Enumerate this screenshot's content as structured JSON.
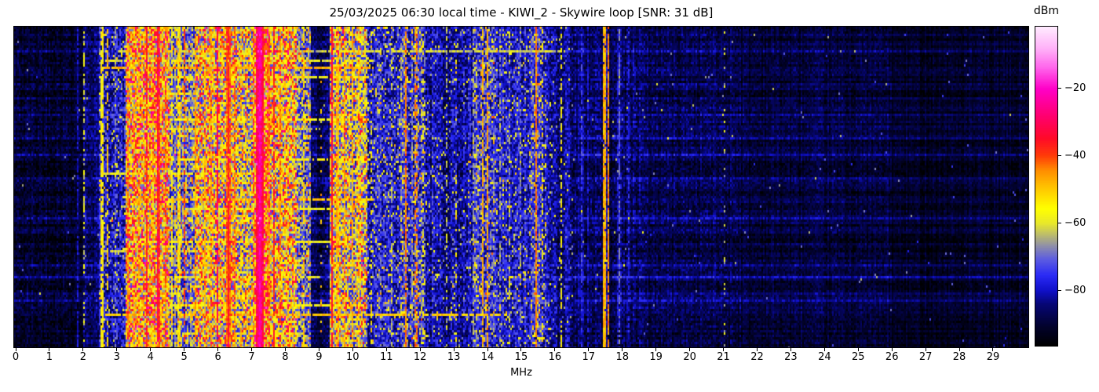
{
  "chart_data": {
    "type": "heatmap",
    "subtype": "radio-spectrum-waterfall",
    "title": "25/03/2025 06:30 local time - KIWI_2 - Skywire loop [SNR: 31 dB]",
    "datetime": "25/03/2025 06:30",
    "receiver": "KIWI_2",
    "antenna": "Skywire loop",
    "snr_db": 31,
    "xlabel": "MHz",
    "x_range_mhz": [
      -0.05,
      30.05
    ],
    "x_ticks": [
      "0",
      "1",
      "2",
      "3",
      "4",
      "5",
      "6",
      "7",
      "8",
      "9",
      "10",
      "11",
      "12",
      "13",
      "14",
      "15",
      "16",
      "17",
      "18",
      "19",
      "20",
      "21",
      "22",
      "23",
      "24",
      "25",
      "26",
      "27",
      "28",
      "29"
    ],
    "colorbar": {
      "label": "dBm",
      "vmax_dbm": -1.6,
      "vmin_dbm": -96.4,
      "ticks": [
        {
          "value": -20,
          "label": "−20"
        },
        {
          "value": -40,
          "label": "−40"
        },
        {
          "value": -60,
          "label": "−60"
        },
        {
          "value": -80,
          "label": "−80"
        }
      ]
    },
    "colormap_stops": [
      [
        0.0,
        [
          0,
          0,
          0
        ]
      ],
      [
        0.06,
        [
          2,
          2,
          45
        ]
      ],
      [
        0.13,
        [
          6,
          6,
          118
        ]
      ],
      [
        0.172,
        [
          16,
          16,
          200
        ]
      ],
      [
        0.22,
        [
          42,
          42,
          245
        ]
      ],
      [
        0.27,
        [
          92,
          92,
          225
        ]
      ],
      [
        0.31,
        [
          140,
          140,
          172
        ]
      ],
      [
        0.345,
        [
          185,
          185,
          112
        ]
      ],
      [
        0.383,
        [
          232,
          232,
          42
        ]
      ],
      [
        0.43,
        [
          255,
          255,
          0
        ]
      ],
      [
        0.5,
        [
          255,
          192,
          0
        ]
      ],
      [
        0.55,
        [
          255,
          140,
          0
        ]
      ],
      [
        0.595,
        [
          255,
          60,
          8
        ]
      ],
      [
        0.65,
        [
          255,
          10,
          40
        ]
      ],
      [
        0.72,
        [
          255,
          0,
          110
        ]
      ],
      [
        0.806,
        [
          255,
          0,
          200
        ]
      ],
      [
        0.87,
        [
          255,
          98,
          235
        ]
      ],
      [
        0.93,
        [
          255,
          175,
          248
        ]
      ],
      [
        1.0,
        [
          255,
          235,
          255
        ]
      ]
    ],
    "noise_floor_bands": [
      {
        "from_mhz": 0.0,
        "to_mhz": 2.0,
        "floor_dbm": -91,
        "spread_db": 10
      },
      {
        "from_mhz": 2.0,
        "to_mhz": 2.45,
        "floor_dbm": -86,
        "spread_db": 12
      },
      {
        "from_mhz": 2.45,
        "to_mhz": 3.25,
        "floor_dbm": -80,
        "spread_db": 18
      },
      {
        "from_mhz": 3.25,
        "to_mhz": 4.55,
        "floor_dbm": -58,
        "spread_db": 30
      },
      {
        "from_mhz": 4.55,
        "to_mhz": 5.35,
        "floor_dbm": -72,
        "spread_db": 22
      },
      {
        "from_mhz": 5.35,
        "to_mhz": 6.55,
        "floor_dbm": -62,
        "spread_db": 28
      },
      {
        "from_mhz": 6.55,
        "to_mhz": 7.05,
        "floor_dbm": -66,
        "spread_db": 26
      },
      {
        "from_mhz": 7.05,
        "to_mhz": 7.55,
        "floor_dbm": -52,
        "spread_db": 28
      },
      {
        "from_mhz": 7.55,
        "to_mhz": 8.35,
        "floor_dbm": -62,
        "spread_db": 28
      },
      {
        "from_mhz": 8.35,
        "to_mhz": 8.75,
        "floor_dbm": -72,
        "spread_db": 22
      },
      {
        "from_mhz": 8.75,
        "to_mhz": 9.3,
        "floor_dbm": -88,
        "spread_db": 12
      },
      {
        "from_mhz": 9.3,
        "to_mhz": 10.45,
        "floor_dbm": -66,
        "spread_db": 26
      },
      {
        "from_mhz": 10.45,
        "to_mhz": 11.4,
        "floor_dbm": -78,
        "spread_db": 18
      },
      {
        "from_mhz": 11.4,
        "to_mhz": 12.15,
        "floor_dbm": -75,
        "spread_db": 20
      },
      {
        "from_mhz": 12.15,
        "to_mhz": 13.55,
        "floor_dbm": -82,
        "spread_db": 16
      },
      {
        "from_mhz": 13.55,
        "to_mhz": 14.2,
        "floor_dbm": -77,
        "spread_db": 20
      },
      {
        "from_mhz": 14.2,
        "to_mhz": 15.3,
        "floor_dbm": -80,
        "spread_db": 16
      },
      {
        "from_mhz": 15.3,
        "to_mhz": 15.75,
        "floor_dbm": -77,
        "spread_db": 18
      },
      {
        "from_mhz": 15.75,
        "to_mhz": 16.55,
        "floor_dbm": -83,
        "spread_db": 14
      },
      {
        "from_mhz": 16.55,
        "to_mhz": 18.6,
        "floor_dbm": -86,
        "spread_db": 12
      },
      {
        "from_mhz": 18.6,
        "to_mhz": 21.5,
        "floor_dbm": -88,
        "spread_db": 10
      },
      {
        "from_mhz": 21.5,
        "to_mhz": 26.0,
        "floor_dbm": -90,
        "spread_db": 8
      },
      {
        "from_mhz": 26.0,
        "to_mhz": 30.1,
        "floor_dbm": -92,
        "spread_db": 6
      }
    ],
    "carriers": [
      {
        "mhz": 1.84,
        "width_mhz": 0.04,
        "peak_dbm": -80,
        "duty": 0.8
      },
      {
        "mhz": 2.04,
        "width_mhz": 0.05,
        "peak_dbm": -60,
        "duty": 0.45
      },
      {
        "mhz": 2.56,
        "width_mhz": 0.07,
        "peak_dbm": -48,
        "duty": 0.85
      },
      {
        "mhz": 2.72,
        "width_mhz": 0.05,
        "peak_dbm": -50,
        "duty": 0.6
      },
      {
        "mhz": 2.95,
        "width_mhz": 0.05,
        "peak_dbm": -70,
        "duty": 0.5
      },
      {
        "mhz": 3.33,
        "width_mhz": 0.06,
        "peak_dbm": -46,
        "duty": 0.8
      },
      {
        "mhz": 3.52,
        "width_mhz": 0.05,
        "peak_dbm": -49,
        "duty": 0.7
      },
      {
        "mhz": 3.64,
        "width_mhz": 0.05,
        "peak_dbm": -42,
        "duty": 0.7
      },
      {
        "mhz": 3.9,
        "width_mhz": 0.07,
        "peak_dbm": -37,
        "duty": 0.9
      },
      {
        "mhz": 4.05,
        "width_mhz": 0.05,
        "peak_dbm": -47,
        "duty": 0.8
      },
      {
        "mhz": 4.22,
        "width_mhz": 0.09,
        "peak_dbm": -33,
        "duty": 0.95
      },
      {
        "mhz": 4.46,
        "width_mhz": 0.05,
        "peak_dbm": -44,
        "duty": 0.7
      },
      {
        "mhz": 4.65,
        "width_mhz": 0.05,
        "peak_dbm": -50,
        "duty": 0.6
      },
      {
        "mhz": 4.85,
        "width_mhz": 0.06,
        "peak_dbm": -47,
        "duty": 0.75
      },
      {
        "mhz": 5.0,
        "width_mhz": 0.05,
        "peak_dbm": -40,
        "duty": 0.6
      },
      {
        "mhz": 5.35,
        "width_mhz": 0.06,
        "peak_dbm": -46,
        "duty": 0.8
      },
      {
        "mhz": 5.62,
        "width_mhz": 0.05,
        "peak_dbm": -49,
        "duty": 0.6
      },
      {
        "mhz": 5.8,
        "width_mhz": 0.05,
        "peak_dbm": -46,
        "duty": 0.7
      },
      {
        "mhz": 5.98,
        "width_mhz": 0.05,
        "peak_dbm": -31,
        "duty": 0.9
      },
      {
        "mhz": 6.3,
        "width_mhz": 0.12,
        "peak_dbm": -36,
        "duty": 0.95
      },
      {
        "mhz": 6.48,
        "width_mhz": 0.04,
        "peak_dbm": -38,
        "duty": 0.8
      },
      {
        "mhz": 6.68,
        "width_mhz": 0.05,
        "peak_dbm": -50,
        "duty": 0.6
      },
      {
        "mhz": 6.88,
        "width_mhz": 0.05,
        "peak_dbm": -52,
        "duty": 0.5
      },
      {
        "mhz": 7.25,
        "width_mhz": 0.22,
        "peak_dbm": -27,
        "duty": 1.0
      },
      {
        "mhz": 7.5,
        "width_mhz": 0.05,
        "peak_dbm": -38,
        "duty": 0.8
      },
      {
        "mhz": 7.65,
        "width_mhz": 0.05,
        "peak_dbm": -37,
        "duty": 0.8
      },
      {
        "mhz": 7.85,
        "width_mhz": 0.06,
        "peak_dbm": -44,
        "duty": 0.8
      },
      {
        "mhz": 8.05,
        "width_mhz": 0.05,
        "peak_dbm": -50,
        "duty": 0.6
      },
      {
        "mhz": 8.25,
        "width_mhz": 0.05,
        "peak_dbm": -53,
        "duty": 0.5
      },
      {
        "mhz": 8.55,
        "width_mhz": 0.05,
        "peak_dbm": -52,
        "duty": 0.55
      },
      {
        "mhz": 9.05,
        "width_mhz": 0.04,
        "peak_dbm": -48,
        "duty": 0.15
      },
      {
        "mhz": 9.4,
        "width_mhz": 0.06,
        "peak_dbm": -35,
        "duty": 0.9
      },
      {
        "mhz": 9.55,
        "width_mhz": 0.05,
        "peak_dbm": -42,
        "duty": 0.8
      },
      {
        "mhz": 9.76,
        "width_mhz": 0.06,
        "peak_dbm": -47,
        "duty": 0.85
      },
      {
        "mhz": 10.0,
        "width_mhz": 0.06,
        "peak_dbm": -48,
        "duty": 0.8
      },
      {
        "mhz": 10.18,
        "width_mhz": 0.05,
        "peak_dbm": -51,
        "duty": 0.55
      },
      {
        "mhz": 10.55,
        "width_mhz": 0.05,
        "peak_dbm": -53,
        "duty": 0.4
      },
      {
        "mhz": 11.15,
        "width_mhz": 0.04,
        "peak_dbm": -62,
        "duty": 0.4
      },
      {
        "mhz": 11.58,
        "width_mhz": 0.06,
        "peak_dbm": -44,
        "duty": 0.9
      },
      {
        "mhz": 11.88,
        "width_mhz": 0.05,
        "peak_dbm": -37,
        "duty": 0.5
      },
      {
        "mhz": 12.1,
        "width_mhz": 0.04,
        "peak_dbm": -58,
        "duty": 0.5
      },
      {
        "mhz": 12.8,
        "width_mhz": 0.04,
        "peak_dbm": -62,
        "duty": 0.4
      },
      {
        "mhz": 13.05,
        "width_mhz": 0.04,
        "peak_dbm": -46,
        "duty": 0.25
      },
      {
        "mhz": 13.6,
        "width_mhz": 0.04,
        "peak_dbm": -58,
        "duty": 0.5
      },
      {
        "mhz": 13.85,
        "width_mhz": 0.05,
        "peak_dbm": -48,
        "duty": 0.7
      },
      {
        "mhz": 14.0,
        "width_mhz": 0.05,
        "peak_dbm": -46,
        "duty": 0.7
      },
      {
        "mhz": 14.35,
        "width_mhz": 0.04,
        "peak_dbm": -58,
        "duty": 0.4
      },
      {
        "mhz": 14.65,
        "width_mhz": 0.04,
        "peak_dbm": -62,
        "duty": 0.35
      },
      {
        "mhz": 15.0,
        "width_mhz": 0.04,
        "peak_dbm": -60,
        "duty": 0.4
      },
      {
        "mhz": 15.45,
        "width_mhz": 0.06,
        "peak_dbm": -44,
        "duty": 0.95
      },
      {
        "mhz": 15.62,
        "width_mhz": 0.04,
        "peak_dbm": -53,
        "duty": 0.4
      },
      {
        "mhz": 16.2,
        "width_mhz": 0.05,
        "peak_dbm": -56,
        "duty": 0.5
      },
      {
        "mhz": 16.8,
        "width_mhz": 0.04,
        "peak_dbm": -75,
        "duty": 0.6
      },
      {
        "mhz": 17.0,
        "width_mhz": 0.04,
        "peak_dbm": -73,
        "duty": 0.6
      },
      {
        "mhz": 17.47,
        "width_mhz": 0.06,
        "peak_dbm": -41,
        "duty": 0.95
      },
      {
        "mhz": 17.58,
        "width_mhz": 0.05,
        "peak_dbm": -45,
        "duty": 0.9
      },
      {
        "mhz": 17.9,
        "width_mhz": 0.04,
        "peak_dbm": -70,
        "duty": 0.7
      },
      {
        "mhz": 18.2,
        "width_mhz": 0.04,
        "peak_dbm": -77,
        "duty": 0.5
      },
      {
        "mhz": 18.45,
        "width_mhz": 0.04,
        "peak_dbm": -79,
        "duty": 0.4
      },
      {
        "mhz": 21.05,
        "width_mhz": 0.04,
        "peak_dbm": -56,
        "duty": 0.3
      }
    ],
    "event_streaks": [
      {
        "t_frac": 0.075,
        "from_mhz": 3.0,
        "to_mhz": 16.3,
        "level_dbm": -62
      },
      {
        "t_frac": 0.105,
        "from_mhz": 2.6,
        "to_mhz": 10.6,
        "level_dbm": -60
      },
      {
        "t_frac": 0.13,
        "from_mhz": 2.6,
        "to_mhz": 10.6,
        "level_dbm": -48
      },
      {
        "t_frac": 0.16,
        "from_mhz": 3.3,
        "to_mhz": 10.5,
        "level_dbm": -58
      },
      {
        "t_frac": 0.205,
        "from_mhz": 3.4,
        "to_mhz": 6.3,
        "level_dbm": -60
      },
      {
        "t_frac": 0.285,
        "from_mhz": 3.5,
        "to_mhz": 10.4,
        "level_dbm": -58
      },
      {
        "t_frac": 0.315,
        "from_mhz": 4.2,
        "to_mhz": 9.0,
        "level_dbm": -62
      },
      {
        "t_frac": 0.415,
        "from_mhz": 3.3,
        "to_mhz": 10.5,
        "level_dbm": -56
      },
      {
        "t_frac": 0.455,
        "from_mhz": 2.6,
        "to_mhz": 7.6,
        "level_dbm": -60
      },
      {
        "t_frac": 0.54,
        "from_mhz": 3.2,
        "to_mhz": 10.6,
        "level_dbm": -50
      },
      {
        "t_frac": 0.57,
        "from_mhz": 5.0,
        "to_mhz": 10.0,
        "level_dbm": -60
      },
      {
        "t_frac": 0.67,
        "from_mhz": 3.4,
        "to_mhz": 10.4,
        "level_dbm": -58
      },
      {
        "t_frac": 0.7,
        "from_mhz": 2.6,
        "to_mhz": 6.5,
        "level_dbm": -62
      },
      {
        "t_frac": 0.78,
        "from_mhz": 3.3,
        "to_mhz": 9.0,
        "level_dbm": -60
      },
      {
        "t_frac": 0.865,
        "from_mhz": 3.5,
        "to_mhz": 10.4,
        "level_dbm": -58
      },
      {
        "t_frac": 0.895,
        "from_mhz": 2.6,
        "to_mhz": 14.5,
        "level_dbm": -50
      },
      {
        "t_frac": 0.955,
        "from_mhz": 3.2,
        "to_mhz": 8.5,
        "level_dbm": -60
      }
    ],
    "render_seed": 42
  }
}
